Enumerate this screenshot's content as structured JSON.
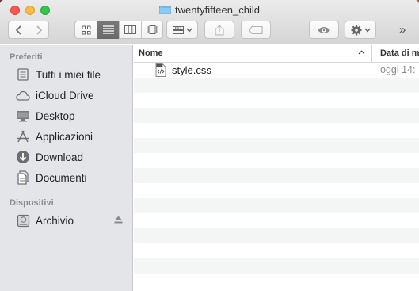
{
  "window": {
    "title": "twentyfifteen_child"
  },
  "toolbar": {
    "overflow_label": "»"
  },
  "sidebar": {
    "sections": [
      {
        "heading": "Preferiti",
        "items": [
          {
            "label": "Tutti i miei file",
            "icon": "all-files-icon"
          },
          {
            "label": "iCloud Drive",
            "icon": "cloud-icon"
          },
          {
            "label": "Desktop",
            "icon": "desktop-icon"
          },
          {
            "label": "Applicazioni",
            "icon": "applications-icon"
          },
          {
            "label": "Download",
            "icon": "download-icon"
          },
          {
            "label": "Documenti",
            "icon": "documents-icon"
          }
        ]
      },
      {
        "heading": "Dispositivi",
        "items": [
          {
            "label": "Archivio",
            "icon": "drive-icon"
          }
        ]
      }
    ]
  },
  "file_list": {
    "columns": [
      "Nome",
      "Data di m"
    ],
    "rows": [
      {
        "name": "style.css",
        "date": "oggi 14:"
      }
    ]
  }
}
